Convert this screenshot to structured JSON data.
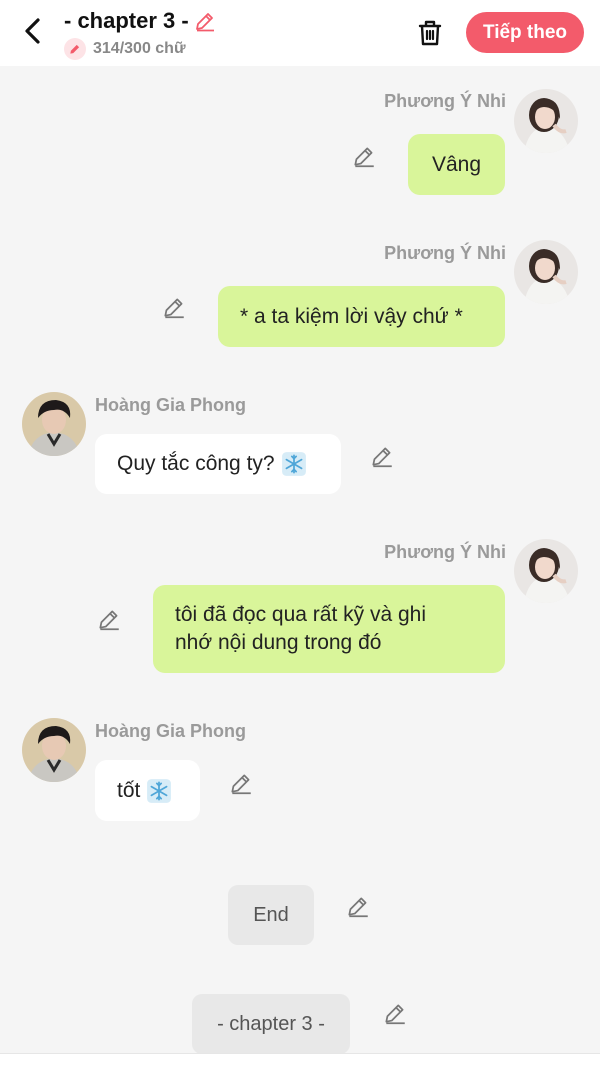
{
  "header": {
    "title": "- chapter 3 -",
    "counter": "314/300 chữ",
    "next_label": "Tiếp theo"
  },
  "colors": {
    "accent": "#f35b6b",
    "my_bubble": "#d9f59a",
    "their_bubble": "#ffffff",
    "background": "#f5f5f5"
  },
  "messages": [
    {
      "sender": "Phương Ý Nhi",
      "side": "right",
      "text": "Vâng"
    },
    {
      "sender": "Phương Ý Nhi",
      "side": "right",
      "text": "* a ta kiệm lời vậy chứ *"
    },
    {
      "sender": "Hoàng Gia Phong",
      "side": "left",
      "text": "Quy tắc công ty?",
      "emoji": "snowflake-icon"
    },
    {
      "sender": "Phương Ý Nhi",
      "side": "right",
      "text_line1": "tôi đã đọc qua rất kỹ và ghi",
      "text_line2": "nhớ nội dung trong đó"
    },
    {
      "sender": "Hoàng Gia Phong",
      "side": "left",
      "text": "tốt",
      "emoji": "snowflake-icon"
    }
  ],
  "end_label": "End",
  "chapter_pill": "- chapter 3 -"
}
